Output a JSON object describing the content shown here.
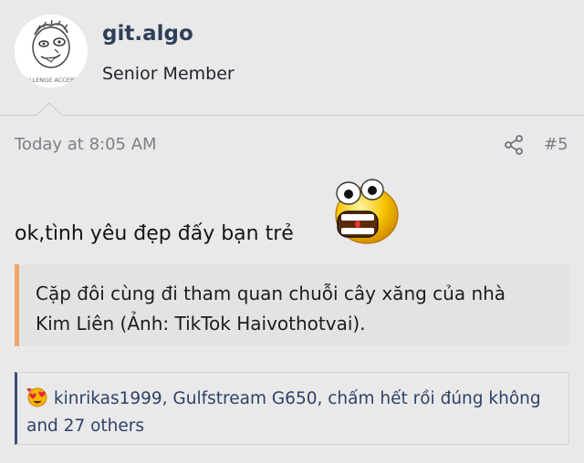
{
  "user": {
    "name": "git.algo",
    "title": "Senior Member",
    "avatar_caption": "CHALLENGE ACCEPTED"
  },
  "post": {
    "time": "Today at 8:05 AM",
    "number": "#5",
    "message": "ok,tình yêu đẹp đấy bạn trẻ",
    "quote_line1": "Cặp đôi cùng đi tham quan chuỗi cây xăng của nhà",
    "quote_line2": "Kim Liên (Ảnh: TikTok Haivothotvai).",
    "reactions_line1": "kinrikas1999, Gulfstream G650, chấm hết rồi đúng không",
    "reactions_line2": "and 27 others"
  },
  "icons": {
    "share": "share-icon",
    "reaction": "heart-eyes-emoji",
    "smiley": "shocked-smiley"
  },
  "colors": {
    "username": "#2f3f5a",
    "quote_accent": "#f3a46b",
    "reaction_accent": "#3a4f72",
    "meta_text": "#7b7f85"
  }
}
